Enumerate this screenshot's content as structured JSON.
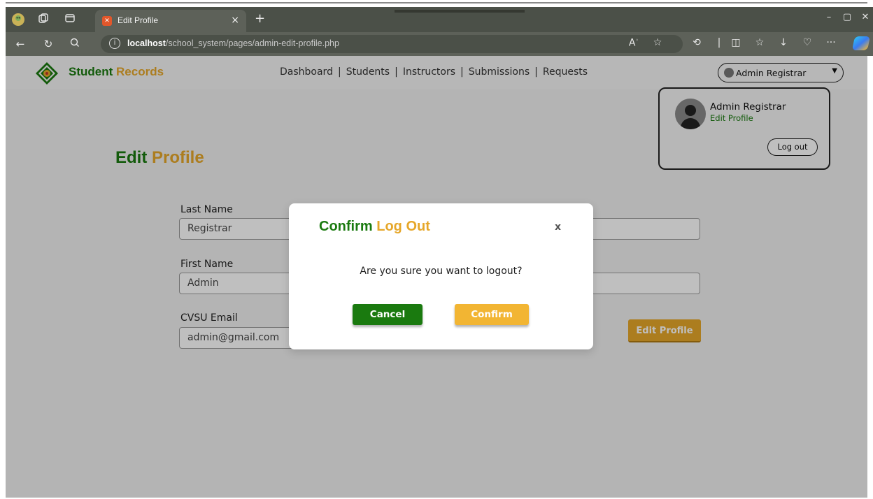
{
  "browser": {
    "tab_title": "Edit Profile",
    "tab_close": "×",
    "new_tab": "+",
    "url_host": "localhost",
    "url_path": "/school_system/pages/admin-edit-profile.php",
    "icons": [
      "profile-icon",
      "workspaces-icon",
      "tab-actions-icon",
      "back-icon",
      "refresh-icon",
      "search-icon",
      "info-icon",
      "read-aloud-icon",
      "favorite-icon",
      "extensions-icon",
      "split-screen-icon",
      "favorites-icon",
      "downloads-icon",
      "health-icon",
      "more-icon",
      "copilot-icon"
    ],
    "window_controls": {
      "minimize": "–",
      "restore": "▢",
      "close": "✕"
    }
  },
  "navbar": {
    "brand_part1": "Student",
    "brand_part2": "Records",
    "links": [
      "Dashboard",
      "Students",
      "Instructors",
      "Submissions",
      "Requests"
    ],
    "separator": "|",
    "user_button": "Admin Registrar"
  },
  "dropdown": {
    "name": "Admin Registrar",
    "edit_profile": "Edit Profile",
    "logout": "Log out"
  },
  "page": {
    "title_part1": "Edit",
    "title_part2": "Profile",
    "fields": [
      {
        "label": "Last Name",
        "value": "Registrar"
      },
      {
        "label": "First Name",
        "value": "Admin"
      },
      {
        "label": "CVSU Email",
        "value": "admin@gmail.com"
      }
    ],
    "edit_button": "Edit Profile"
  },
  "modal": {
    "title_part1": "Confirm",
    "title_part2": "Log Out",
    "close": "x",
    "message": "Are you sure you want to logout?",
    "cancel": "Cancel",
    "confirm": "Confirm"
  },
  "colors": {
    "brand_green": "#1a7a0f",
    "brand_gold": "#e6a72a",
    "confirm_gold": "#f2b533"
  }
}
